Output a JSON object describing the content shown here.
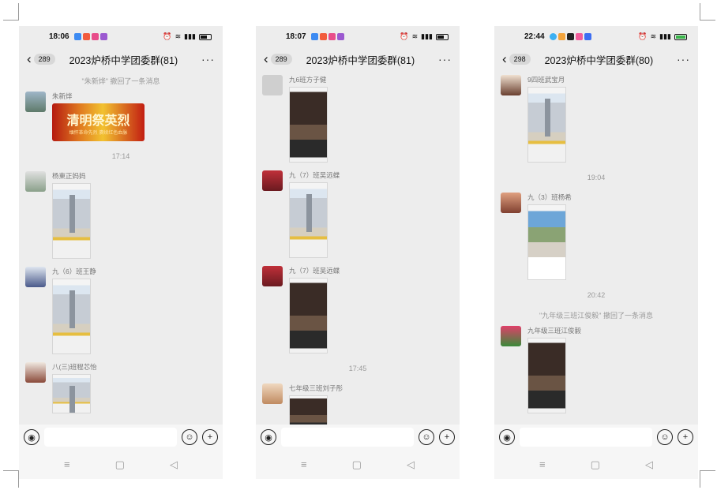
{
  "phones": [
    {
      "status_time": "18:06",
      "unread_count": "289",
      "title": "2023炉桥中学团委群(81)",
      "recall_notice": "\"朱新烨\" 撤回了一条消息",
      "msg1": {
        "sender": "朱新烨",
        "banner_title": "清明祭英烈",
        "banner_sub": "缅怀革命先烈 赓续红色血脉"
      },
      "timestamp": "17:14",
      "msg2": {
        "sender": "杨東正妈妈"
      },
      "msg3": {
        "sender": "九（6）班王静"
      },
      "msg4": {
        "sender": "八(三)班程芯怡"
      }
    },
    {
      "status_time": "18:07",
      "unread_count": "289",
      "title": "2023炉桥中学团委群(81)",
      "msg1": {
        "sender": "九6班方子健"
      },
      "msg2": {
        "sender": "九（7）班吴远蝶"
      },
      "msg3": {
        "sender": "九（7）班吴远蝶"
      },
      "timestamp": "17:45",
      "msg4": {
        "sender": "七年级三班刘子彤"
      }
    },
    {
      "status_time": "22:44",
      "unread_count": "298",
      "title": "2023炉桥中学团委群(80)",
      "msg1": {
        "sender": "9四班武宝月"
      },
      "timestamp1": "19:04",
      "msg2": {
        "sender": "九（3）班杨希"
      },
      "timestamp2": "20:42",
      "recall_notice": "\"九年级三班江俊毅\" 撤回了一条消息",
      "msg3": {
        "sender": "九年级三班江俊毅"
      }
    }
  ],
  "icons": {
    "back": "‹",
    "more": "···",
    "voice": "◉",
    "emoji": "☺",
    "plus": "+",
    "nav_menu": "≡",
    "nav_home": "▢",
    "nav_back": "◁"
  },
  "colors": {
    "chat_bg": "#ededed",
    "muted_text": "#9a9a9a",
    "banner_red": "#b51a10"
  }
}
